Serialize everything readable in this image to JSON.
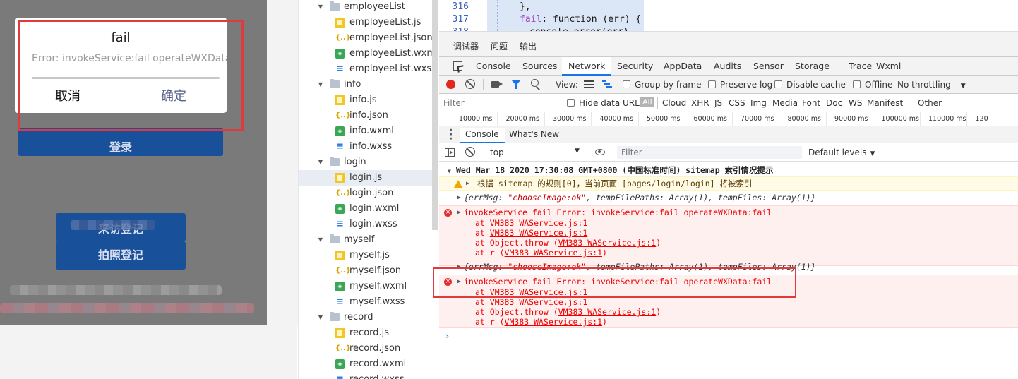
{
  "dialog": {
    "title": "fail",
    "message": "Error: invokeService:fail operateWXData:fail",
    "cancel_label": "取消",
    "confirm_label": "确定"
  },
  "simulator": {
    "login_button": "登录",
    "register_button": "来访登记",
    "photo_register_button": "拍照登记"
  },
  "file_tree": {
    "items": [
      {
        "label": "employeeList",
        "type": "folder"
      },
      {
        "label": "employeeList.js",
        "type": "js"
      },
      {
        "label": "employeeList.json",
        "type": "json"
      },
      {
        "label": "employeeList.wxml",
        "type": "wxml"
      },
      {
        "label": "employeeList.wxss",
        "type": "wxss"
      },
      {
        "label": "info",
        "type": "folder"
      },
      {
        "label": "info.js",
        "type": "js"
      },
      {
        "label": "info.json",
        "type": "json"
      },
      {
        "label": "info.wxml",
        "type": "wxml"
      },
      {
        "label": "info.wxss",
        "type": "wxss"
      },
      {
        "label": "login",
        "type": "folder"
      },
      {
        "label": "login.js",
        "type": "js",
        "selected": true
      },
      {
        "label": "login.json",
        "type": "json"
      },
      {
        "label": "login.wxml",
        "type": "wxml"
      },
      {
        "label": "login.wxss",
        "type": "wxss"
      },
      {
        "label": "myself",
        "type": "folder"
      },
      {
        "label": "myself.js",
        "type": "js"
      },
      {
        "label": "myself.json",
        "type": "json"
      },
      {
        "label": "myself.wxml",
        "type": "wxml"
      },
      {
        "label": "myself.wxss",
        "type": "wxss"
      },
      {
        "label": "record",
        "type": "folder"
      },
      {
        "label": "record.js",
        "type": "js"
      },
      {
        "label": "record.json",
        "type": "json"
      },
      {
        "label": "record.wxml",
        "type": "wxml"
      },
      {
        "label": "record.wxss",
        "type": "wxss"
      }
    ]
  },
  "editor": {
    "lines": [
      {
        "num": "316",
        "text": "},"
      },
      {
        "num": "317",
        "text_key": "fail",
        "text_rest": ": function (err) {"
      },
      {
        "num": "318",
        "text": "console.error(err)"
      }
    ]
  },
  "panel_tabs": {
    "debugger": "调试器",
    "issues": "问题",
    "output": "输出"
  },
  "devtools_tabs": [
    "Console",
    "Sources",
    "Network",
    "Security",
    "AppData",
    "Audits",
    "Sensor",
    "Storage",
    "Trace",
    "Wxml"
  ],
  "active_devtools_tab": "Network",
  "network_toolbar": {
    "view_label": "View:",
    "group_by_frame": "Group by frame",
    "preserve_log": "Preserve log",
    "disable_cache": "Disable cache",
    "offline": "Offline",
    "throttling": "No throttling"
  },
  "filter_bar": {
    "placeholder": "Filter",
    "hide_data_urls": "Hide data URLs",
    "all": "All",
    "types": [
      "Cloud",
      "XHR",
      "JS",
      "CSS",
      "Img",
      "Media",
      "Font",
      "Doc",
      "WS",
      "Manifest",
      "Other"
    ]
  },
  "timeline_ticks": [
    "10000 ms",
    "20000 ms",
    "30000 ms",
    "40000 ms",
    "50000 ms",
    "60000 ms",
    "70000 ms",
    "80000 ms",
    "90000 ms",
    "100000 ms",
    "110000 ms",
    "120"
  ],
  "drawer_tabs": {
    "console": "Console",
    "whats_new": "What's New"
  },
  "console_toolbar": {
    "context": "top",
    "filter_placeholder": "Filter",
    "levels": "Default levels"
  },
  "console": {
    "group_header": "Wed Mar 18 2020 17:30:08 GMT+0800 (中国标准时间) sitemap 索引情况提示",
    "warning": "根据 sitemap 的规则[0]，当前页面 [pages/login/login] 将被索引",
    "log1_prefix": "{errMsg: ",
    "log1_str": "\"chooseImage:ok\"",
    "log1_rest": ", tempFilePaths: Array(1), tempFiles: Array(1)}",
    "error_text": "invokeService fail Error: invokeService:fail operateWXData:fail",
    "stack": [
      {
        "prefix": "at ",
        "link": "VM383 WAService.js:1"
      },
      {
        "prefix": "at ",
        "link": "VM383 WAService.js:1"
      },
      {
        "prefix": "at Object.throw (",
        "link": "VM383 WAService.js:1",
        "suffix": ")"
      },
      {
        "prefix": "at r (",
        "link": "VM383 WAService.js:1",
        "suffix": ")"
      }
    ],
    "prompt": "›"
  }
}
